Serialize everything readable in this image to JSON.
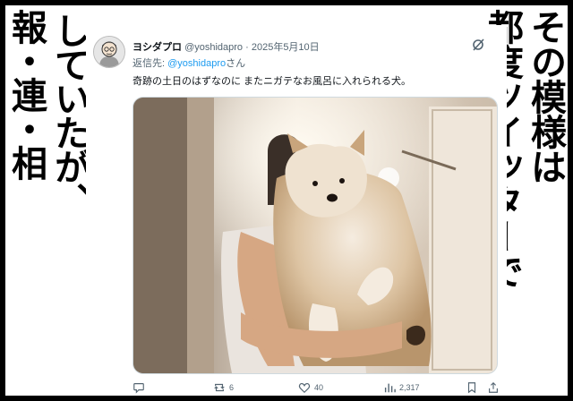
{
  "caption": {
    "left_col1": "報・連・相",
    "left_col2": "していたが、",
    "right_col1": "その模様は",
    "right_col2": "都度ツイッターで"
  },
  "tweet": {
    "author_name": "ヨシダプロ",
    "handle": "@yoshidapro",
    "separator": "·",
    "date": "2025年5月10日",
    "reply_prefix": "返信先:",
    "reply_mention": "@yoshidapro",
    "reply_suffix": "さん",
    "text": "奇跡の土日のはずなのに またニガテなお風呂に入れられる犬。",
    "icons": {
      "grok": "grok-icon",
      "reply": "reply-icon",
      "retweet": "retweet-icon",
      "like": "heart-icon",
      "views": "views-icon",
      "bookmark": "bookmark-icon",
      "share": "share-icon"
    },
    "counts": {
      "retweets": "6",
      "likes": "40",
      "views": "2,317"
    }
  },
  "colors": {
    "link": "#1d9bf0",
    "muted": "#536471",
    "text": "#0f1419"
  }
}
